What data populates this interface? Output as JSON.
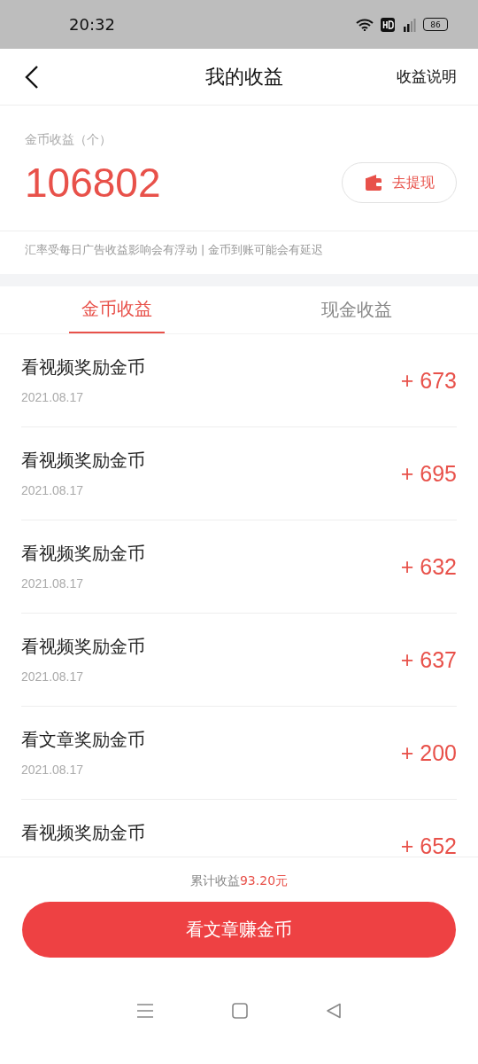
{
  "status_bar": {
    "time": "20:32",
    "battery": "86"
  },
  "header": {
    "title": "我的收益",
    "action": "收益说明"
  },
  "summary": {
    "label": "金币收益（个）",
    "value": "106802",
    "withdraw_button": "去提现"
  },
  "note": "汇率受每日广告收益影响会有浮动 | 金币到账可能会有延迟",
  "tabs": [
    {
      "label": "金币收益",
      "selected": true
    },
    {
      "label": "现金收益",
      "selected": false
    }
  ],
  "records": [
    {
      "title": "看视频奖励金币",
      "date": "2021.08.17",
      "amount": "+ 673"
    },
    {
      "title": "看视频奖励金币",
      "date": "2021.08.17",
      "amount": "+ 695"
    },
    {
      "title": "看视频奖励金币",
      "date": "2021.08.17",
      "amount": "+ 632"
    },
    {
      "title": "看视频奖励金币",
      "date": "2021.08.17",
      "amount": "+ 637"
    },
    {
      "title": "看文章奖励金币",
      "date": "2021.08.17",
      "amount": "+ 200"
    },
    {
      "title": "看视频奖励金币",
      "amount": "+ 652"
    }
  ],
  "footer": {
    "total_label": "累计收益",
    "total_value": "93.20元",
    "cta_button": "看文章赚金币"
  }
}
